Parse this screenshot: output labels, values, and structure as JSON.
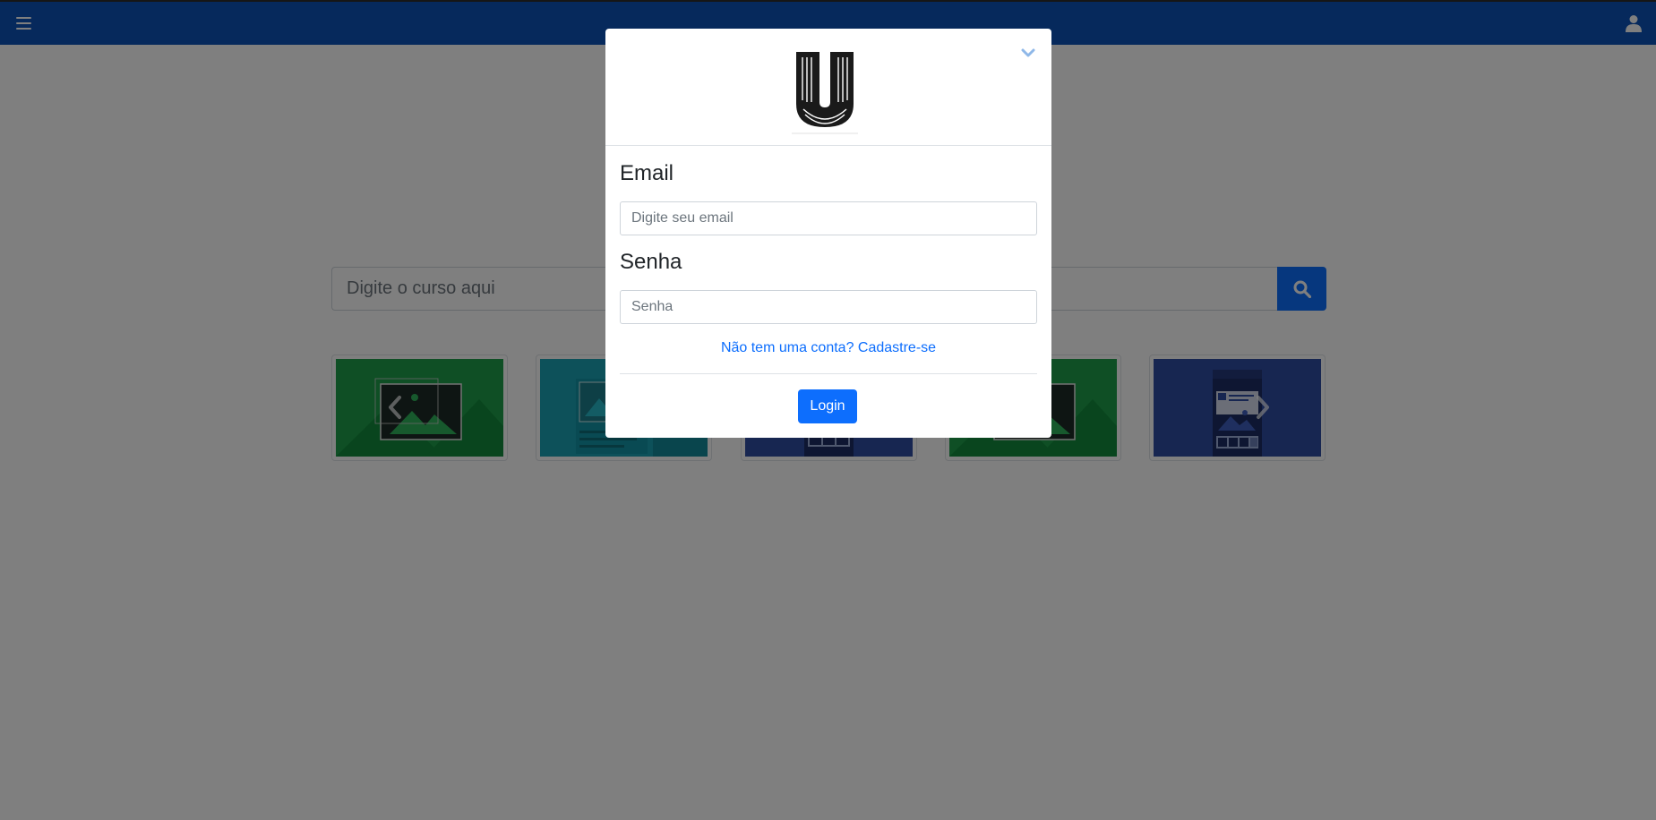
{
  "header": {
    "menu_icon": "hamburger-menu-icon",
    "user_icon": "user-icon",
    "background_color": "#0d52b8"
  },
  "search": {
    "placeholder": "Digite o curso aqui",
    "button_icon": "search-icon",
    "button_color": "#0d6efd"
  },
  "carousel": {
    "prev_icon": "chevron-left-icon",
    "next_icon": "chevron-right-icon",
    "items": [
      {
        "image": "image-placeholder-green",
        "color": "#1e9e4a"
      },
      {
        "image": "layout-placeholder-teal",
        "color": "#1aa3b5"
      },
      {
        "image": "phone-mockup-navy",
        "color": "#2f4ca3"
      },
      {
        "image": "image-placeholder-green",
        "color": "#1e9e4a"
      },
      {
        "image": "phone-mockup-navy",
        "color": "#2f4ca3"
      }
    ]
  },
  "modal": {
    "logo_icon": "u-letter-logo",
    "collapse_icon": "chevron-down-icon",
    "email_label": "Email",
    "email_placeholder": "Digite seu email",
    "password_label": "Senha",
    "password_placeholder": "Senha",
    "signup_link": "Não tem uma conta? Cadastre-se",
    "login_button": "Login",
    "link_color": "#0d6efd"
  }
}
